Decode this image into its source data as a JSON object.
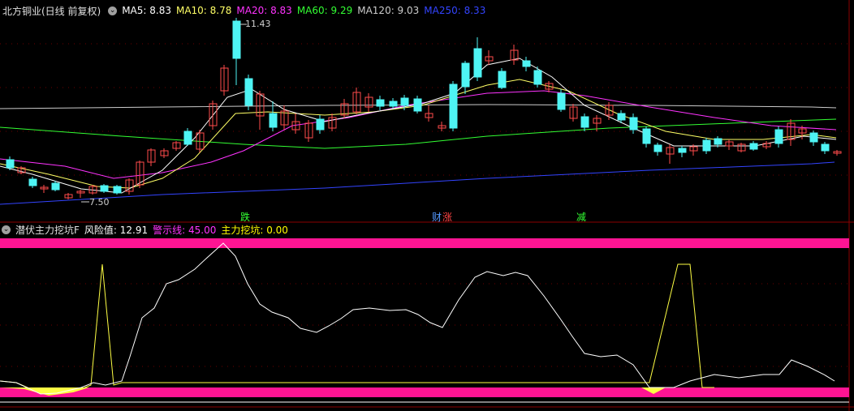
{
  "main_panel": {
    "stock_title": "北方铜业(日线 前复权)",
    "ma_items": [
      {
        "label": "MA5: 8.83",
        "color": "#ffffff"
      },
      {
        "label": "MA10: 8.78",
        "color": "#ffff66"
      },
      {
        "label": "MA20: 8.83",
        "color": "#ff33ff"
      },
      {
        "label": "MA60: 9.29",
        "color": "#33ff33"
      },
      {
        "label": "MA120: 9.03",
        "color": "#cccccc"
      },
      {
        "label": "MA250: 8.33",
        "color": "#3344ff"
      }
    ],
    "high_label": "11.43",
    "low_label": "7.50",
    "markers": [
      {
        "text": "跌",
        "color": "#33ff33"
      },
      {
        "text": "财",
        "color": "#5599ff"
      },
      {
        "text": "涨",
        "color": "#ff4444"
      },
      {
        "text": "减",
        "color": "#33ff33"
      }
    ]
  },
  "indicator_panel": {
    "name": "潜伏主力挖坑F",
    "items": [
      {
        "label": "风险值: 12.91",
        "color": "#ffffff"
      },
      {
        "label": "警示线: 45.00",
        "color": "#ff33ff"
      },
      {
        "label": "主力挖坑: 0.00",
        "color": "#ffff00"
      }
    ]
  },
  "colors": {
    "up": "#ff4b4b",
    "down": "#4ef4f4",
    "warning_band": "#ff1493",
    "yellow": "#ffff44"
  },
  "icons": [
    "collapse-circle-icon",
    "collapse-circle-icon"
  ]
}
